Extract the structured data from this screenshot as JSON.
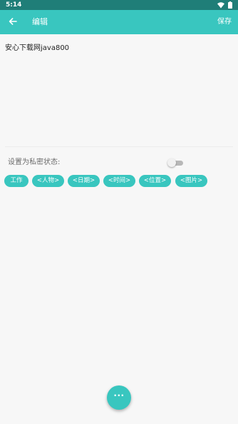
{
  "status_bar": {
    "time": "5:14",
    "icons": [
      "wifi-icon",
      "battery-icon"
    ]
  },
  "app_bar": {
    "back_icon": "arrow-left-icon",
    "title": "编辑",
    "save_label": "保存"
  },
  "editor": {
    "content": "安心下载网java800"
  },
  "private_setting": {
    "label": "设置为私密状态:",
    "enabled": false
  },
  "tags": [
    {
      "label": "工作"
    },
    {
      "label": "<人物>"
    },
    {
      "label": "<日期>"
    },
    {
      "label": "<时间>"
    },
    {
      "label": "<位置>"
    },
    {
      "label": "<图片>"
    }
  ],
  "fab": {
    "label": "···",
    "icon": "more-icon"
  },
  "colors": {
    "primary": "#39c6bf",
    "status_bar": "#1f7e78",
    "background": "#f7f7f7"
  }
}
